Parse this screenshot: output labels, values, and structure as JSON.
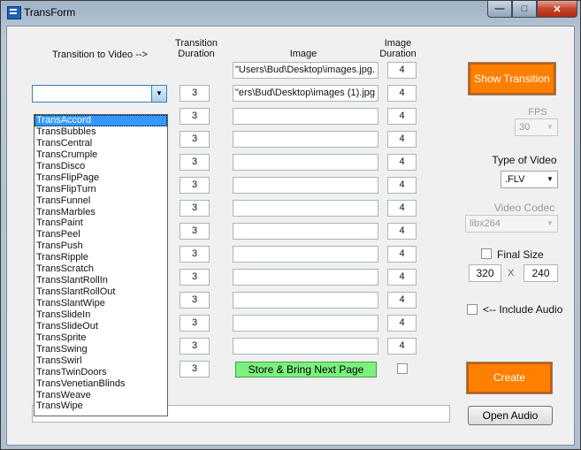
{
  "window": {
    "title": "TransForm",
    "minimize": "—",
    "maximize": "□",
    "close": "✕"
  },
  "headers": {
    "transition_to_video": "Transition to Video -->",
    "transition_duration": "Transition Duration",
    "image": "Image",
    "image_duration": "Image Duration"
  },
  "transition_combo": {
    "value": ""
  },
  "transition_durations": [
    "3",
    "3",
    "3",
    "3",
    "3",
    "3",
    "3",
    "3",
    "3",
    "3",
    "3",
    "3",
    "3"
  ],
  "images": [
    ".Users\\Bud\\Desktop\\images.jpg\"",
    "ers\\Bud\\Desktop\\images (1).jpg\"",
    "",
    "",
    "",
    "",
    "",
    "",
    "",
    "",
    "",
    "",
    ""
  ],
  "image_durations": [
    "4",
    "4",
    "4",
    "4",
    "4",
    "4",
    "4",
    "4",
    "4",
    "4",
    "4",
    "4",
    "4"
  ],
  "dropdown_items": [
    "TransAccord",
    "TransBubbles",
    "TransCentral",
    "TransCrumple",
    "TransDisco",
    "TransFlipPage",
    "TransFlipTurn",
    "TransFunnel",
    "TransMarbles",
    "TransPaint",
    "TransPeel",
    "TransPush",
    "TransRipple",
    "TransScratch",
    "TransSlantRollIn",
    "TransSlantRollOut",
    "TransSlantWipe",
    "TransSlideIn",
    "TransSlideOut",
    "TransSprite",
    "TransSwing",
    "TransSwirl",
    "TransTwinDoors",
    "TransVenetianBlinds",
    "TransWeave",
    "TransWipe"
  ],
  "dropdown_selected_index": 0,
  "buttons": {
    "show_transition": "Show Transition",
    "store_next": "Store & Bring Next Page",
    "create": "Create",
    "open_audio": "Open Audio"
  },
  "fps": {
    "label": "FPS",
    "value": "30"
  },
  "video_type": {
    "label": "Type of Video",
    "value": ".FLV"
  },
  "video_codec": {
    "label": "Video Codec",
    "value": "libx264"
  },
  "final_size": {
    "label": "Final Size",
    "width": "320",
    "separator": "X",
    "height": "240"
  },
  "include_audio": {
    "label": "<-- Include Audio"
  },
  "audio_path": {
    "value": ""
  },
  "colors": {
    "accent_orange": "#ff7f00",
    "store_green": "#7cf07c",
    "selection_blue": "#3399ff"
  }
}
